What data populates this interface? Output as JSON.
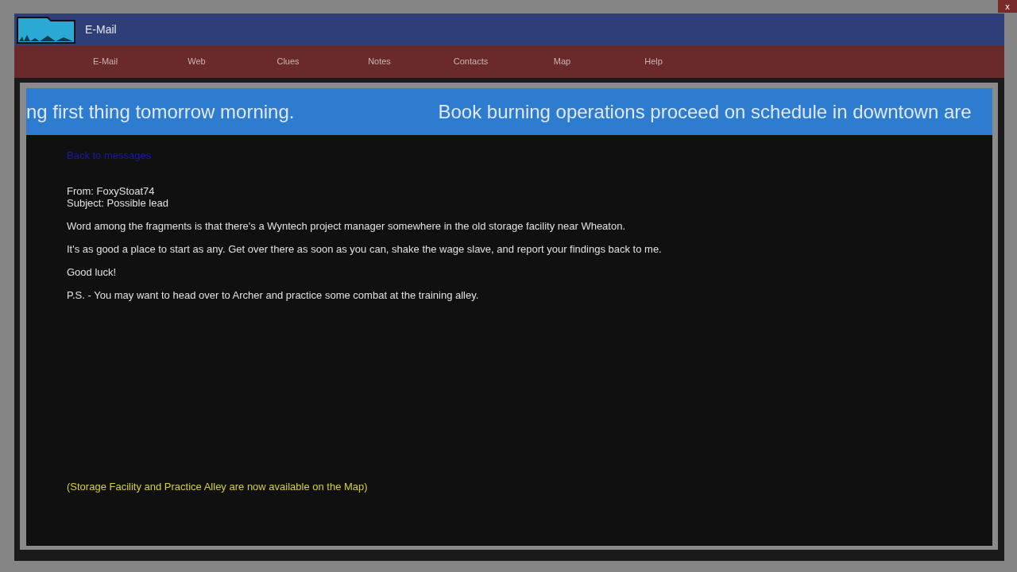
{
  "close_button": "x",
  "window": {
    "title": "E-Mail"
  },
  "nav": [
    "E-Mail",
    "Web",
    "Clues",
    "Notes",
    "Contacts",
    "Map",
    "Help"
  ],
  "ticker": [
    "ng first thing tomorrow morning.",
    "Book burning operations proceed on schedule in downtown are"
  ],
  "back_link": "Back to messages",
  "message": {
    "from": "From: FoxyStoat74",
    "subject": "Subject: Possible lead",
    "paragraphs": [
      "Word among the fragments is that there's a Wyntech project manager somewhere in the old storage facility near Wheaton.",
      "It's as good a place to start as any. Get over there as soon as you can, shake the wage slave, and report your findings back to me.",
      "Good luck!",
      "P.S. - You may want to head over to Archer and practice some combat at the training alley."
    ]
  },
  "notice": "(Storage Facility and Practice Alley are now available on the Map)"
}
